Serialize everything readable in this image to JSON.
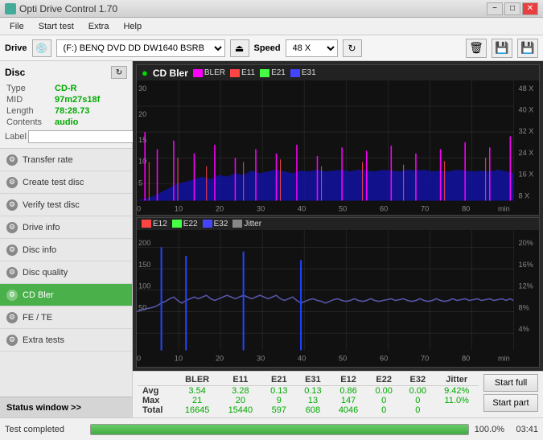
{
  "titlebar": {
    "icon": "disc",
    "title": "Opti Drive Control 1.70",
    "min": "−",
    "max": "□",
    "close": "✕"
  },
  "menu": {
    "items": [
      "File",
      "Start test",
      "Extra",
      "Help"
    ]
  },
  "drivebar": {
    "drive_label": "Drive",
    "drive_value": "(F:)  BENQ DVD DD DW1640 BSRB",
    "speed_label": "Speed",
    "speed_value": "48 X"
  },
  "sidebar": {
    "disc_title": "Disc",
    "disc_type_label": "Type",
    "disc_type_value": "CD-R",
    "disc_mid_label": "MID",
    "disc_mid_value": "97m27s18f",
    "disc_length_label": "Length",
    "disc_length_value": "78:28.73",
    "disc_contents_label": "Contents",
    "disc_contents_value": "audio",
    "disc_label_label": "Label",
    "nav_items": [
      {
        "id": "transfer-rate",
        "label": "Transfer rate",
        "active": false
      },
      {
        "id": "create-test-disc",
        "label": "Create test disc",
        "active": false
      },
      {
        "id": "verify-test-disc",
        "label": "Verify test disc",
        "active": false
      },
      {
        "id": "drive-info",
        "label": "Drive info",
        "active": false
      },
      {
        "id": "disc-info",
        "label": "Disc info",
        "active": false
      },
      {
        "id": "disc-quality",
        "label": "Disc quality",
        "active": false
      },
      {
        "id": "cd-bler",
        "label": "CD Bler",
        "active": true
      },
      {
        "id": "fe-te",
        "label": "FE / TE",
        "active": false
      },
      {
        "id": "extra-tests",
        "label": "Extra tests",
        "active": false
      }
    ],
    "status_window": "Status window >>"
  },
  "charts": {
    "top": {
      "title": "CD Bler",
      "legends": [
        {
          "label": "BLER",
          "color": "#ff00ff"
        },
        {
          "label": "E11",
          "color": "#ff4444"
        },
        {
          "label": "E21",
          "color": "#44ff44"
        },
        {
          "label": "E31",
          "color": "#4444ff"
        }
      ],
      "y_max": 30,
      "y_right_labels": [
        "8 X",
        "16 X",
        "24 X",
        "32 X",
        "40 X",
        "48 X"
      ],
      "x_labels": [
        "0",
        "10",
        "20",
        "30",
        "40",
        "50",
        "60",
        "70",
        "80"
      ],
      "x_unit": "min"
    },
    "bottom": {
      "legends": [
        {
          "label": "E12",
          "color": "#ff4444"
        },
        {
          "label": "E22",
          "color": "#44ff44"
        },
        {
          "label": "E32",
          "color": "#4444ff"
        },
        {
          "label": "Jitter",
          "color": "#888888"
        }
      ],
      "y_max": 200,
      "y_right_labels": [
        "4%",
        "8%",
        "12%",
        "16%",
        "20%"
      ],
      "x_labels": [
        "0",
        "10",
        "20",
        "30",
        "40",
        "50",
        "60",
        "70",
        "80"
      ],
      "x_unit": "min"
    }
  },
  "stats": {
    "headers": [
      "",
      "BLER",
      "E11",
      "E21",
      "E31",
      "E12",
      "E22",
      "E32",
      "Jitter"
    ],
    "rows": [
      {
        "label": "Avg",
        "values": [
          "3.54",
          "3.28",
          "0.13",
          "0.13",
          "0.86",
          "0.00",
          "0.00",
          "9.42%"
        ]
      },
      {
        "label": "Max",
        "values": [
          "21",
          "20",
          "9",
          "13",
          "147",
          "0",
          "0",
          "11.0%"
        ]
      },
      {
        "label": "Total",
        "values": [
          "16645",
          "15440",
          "597",
          "608",
          "4046",
          "0",
          "0",
          ""
        ]
      }
    ],
    "start_full_label": "Start full",
    "start_part_label": "Start part"
  },
  "bottombar": {
    "status": "Test completed",
    "progress": 100,
    "progress_text": "100.0%",
    "time": "03:41"
  }
}
